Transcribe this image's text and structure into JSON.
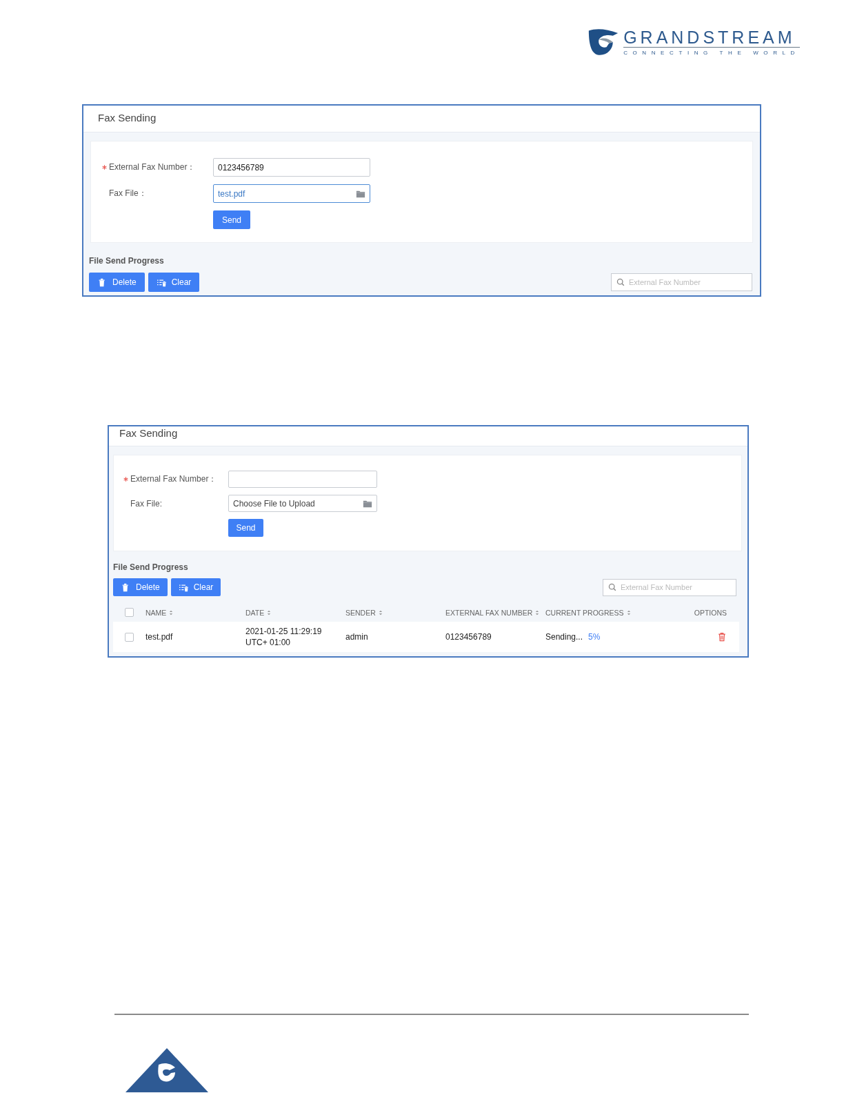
{
  "header": {
    "logo": {
      "name": "GRANDSTREAM",
      "tagline": "CONNECTING THE WORLD"
    }
  },
  "screenshots": [
    {
      "title": "Fax Sending",
      "form": {
        "fields": [
          {
            "kind": "text",
            "label": "External Fax Number：",
            "required": true,
            "focused": false,
            "value": "0123456789"
          },
          {
            "kind": "file",
            "label": "Fax File：",
            "required": false,
            "focused": true,
            "value": "test.pdf"
          }
        ],
        "button": "Send"
      },
      "progress": {
        "title": "File Send Progress",
        "buttons": [
          {
            "kind": "delete",
            "label": "Delete"
          },
          {
            "kind": "clear",
            "label": "Clear"
          }
        ],
        "search": {
          "placeholder": "External Fax Number"
        }
      }
    },
    {
      "title": "Fax Sending",
      "form": {
        "fields": [
          {
            "kind": "text",
            "label": "External Fax Number：",
            "required": true,
            "focused": false
          },
          {
            "kind": "file",
            "label": "Fax File:",
            "required": false,
            "focused": false,
            "placeholder": "Choose File to Upload"
          }
        ],
        "button": "Send"
      },
      "progress": {
        "title": "File Send Progress",
        "buttons": [
          {
            "kind": "delete",
            "label": "Delete"
          },
          {
            "kind": "clear",
            "label": "Clear"
          }
        ],
        "search": {
          "placeholder": "External Fax Number"
        },
        "table": {
          "header_checked": false,
          "columns": [
            {
              "label": "NAME",
              "sortable": true
            },
            {
              "label": "DATE",
              "sortable": true
            },
            {
              "label": "SENDER",
              "sortable": true
            },
            {
              "label": "EXTERNAL FAX NUMBER",
              "sortable": true
            },
            {
              "label": "CURRENT PROGRESS",
              "sortable": true
            },
            {
              "label": "OPTIONS",
              "sortable": false
            }
          ],
          "rows": [
            {
              "checked": false,
              "name": "test.pdf",
              "date": "2021-01-25 11:29:19 UTC+ 01:00",
              "sender": "admin",
              "external_fax_number": "0123456789",
              "progress_status": "Sending...",
              "progress_percent": "5%",
              "deletable": true
            }
          ]
        }
      }
    }
  ]
}
